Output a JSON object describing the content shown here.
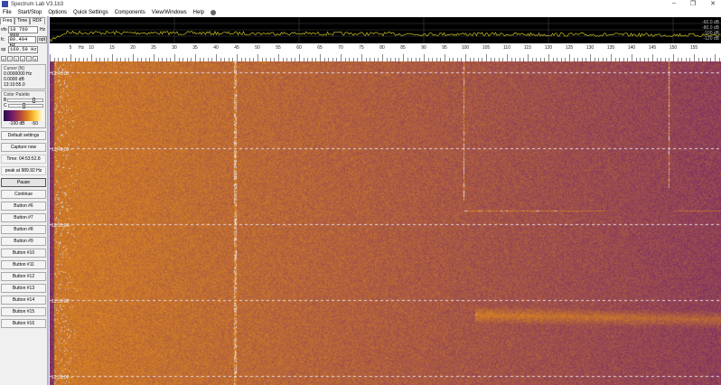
{
  "window": {
    "title": "Spectrum Lab V3.1b3",
    "controls": [
      "–",
      "❐",
      "✕"
    ]
  },
  "menu": [
    "File",
    "Start/Stop",
    "Options",
    "Quick Settings",
    "Components",
    "View/Windows",
    "Help"
  ],
  "tabs": [
    "Freq",
    "Time",
    "RDF"
  ],
  "vfo": {
    "label": "vfo",
    "value": "10 760 000",
    "unit": "Hz"
  },
  "fc": {
    "label": "fc",
    "value": "80.494 Hz",
    "button": "opt"
  },
  "sp": {
    "label": "sp",
    "value": "160.59 Hz"
  },
  "nav_arrows": [
    "«",
    "‹",
    "<",
    ">",
    "›",
    "»"
  ],
  "cursor": {
    "title": "Cursor [N]",
    "freq": "0.0000000 Hz",
    "level": "0.0000 dB",
    "time": "13:10:55.0"
  },
  "palette": {
    "title": "Color Palette",
    "b_label": "B",
    "c_label": "C",
    "min": "-100 dB",
    "max": "-50",
    "brightness": 0.72,
    "contrast": 0.42
  },
  "buttons": {
    "default": "Default settings",
    "capture": "Capture now",
    "time": "Time: 04:53:52.8",
    "peak": "peak at 989.92 Hz",
    "pause": "Pause",
    "continue": "Continue",
    "numbered": [
      "Button #6",
      "Button #7",
      "Button #8",
      "Button #9",
      "Button #10",
      "Button #11",
      "Button #12",
      "Button #13",
      "Button #14",
      "Button #15",
      "Button #16"
    ]
  },
  "spectrum": {
    "db_labels": [
      "-60.0 dB",
      "-80.0 dB",
      "-100 dB",
      "-120 dB"
    ],
    "trace_color": "#c8c020"
  },
  "freq_axis": {
    "unit": "Hz",
    "ticks": [
      5,
      10,
      15,
      20,
      25,
      30,
      35,
      40,
      45,
      50,
      55,
      60,
      65,
      70,
      75,
      80,
      85,
      90,
      95,
      100,
      105,
      110,
      115,
      120,
      125,
      130,
      135,
      140,
      145,
      150,
      155
    ]
  },
  "waterfall": {
    "time_labels": [
      "12:45:00",
      "12:40:00",
      "12:35:00",
      "12:30:00",
      "12:25:00"
    ],
    "colors": {
      "hot": "#e08a1c",
      "cold": "#6a2070"
    }
  }
}
